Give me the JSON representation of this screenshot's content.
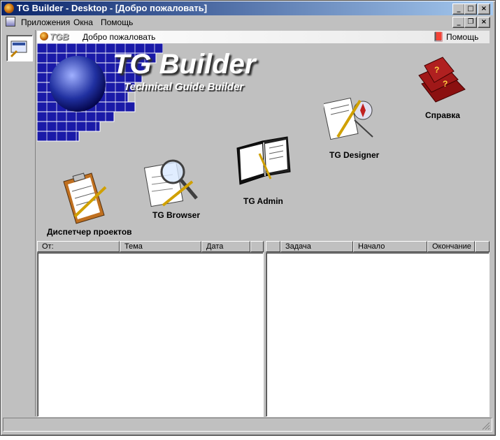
{
  "window": {
    "title": "TG Builder - Desktop - [Добро пожаловать]"
  },
  "menu": {
    "items": [
      "Приложения",
      "Окна",
      "Помощь"
    ]
  },
  "inner": {
    "logo_text": "TGB",
    "title": "Добро пожаловать",
    "help_label": "Помощь"
  },
  "banner": {
    "title": "TG Builder",
    "subtitle": "Technical Guide Builder"
  },
  "apps": {
    "project_manager": "Диспетчер проектов",
    "browser": "TG Browser",
    "admin": "TG Admin",
    "designer": "TG Designer",
    "help": "Справка"
  },
  "messages": {
    "columns": [
      "От:",
      "Тема",
      "Дата"
    ]
  },
  "tasks": {
    "columns": [
      "Задача",
      "Начало",
      "Окончание"
    ]
  },
  "colors": {
    "title_start": "#0a246a",
    "title_end": "#a6caf0",
    "banner_blue": "#1a1aa8"
  }
}
